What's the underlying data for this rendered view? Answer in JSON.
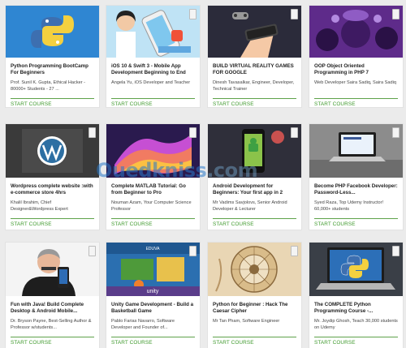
{
  "cta_label": "START COURSE",
  "courses": [
    {
      "title": "Python Programming BootCamp For Beginners",
      "author": "Prof. Sunil K. Gupta, Ethical Hacker - 80000+ Students - 27 ..."
    },
    {
      "title": "iOS 10 & Swift 3 - Mobile App Development Beginning to End",
      "author": "Angela Yu, iOS Developer and Teacher"
    },
    {
      "title": "BUILD VIRTUAL REALITY GAMES FOR GOOGLE",
      "author": "Dinesh Tavasalkar, Engineer, Developer, Technical Trainer"
    },
    {
      "title": "OOP Object Oriented Programming in PHP 7",
      "author": "Web Developer Saira Sadiq, Saira Sadiq"
    },
    {
      "title": "Wordpress complete website :with e-commerce store 4hrs",
      "author": "Khalil Ibrahim, Chief Designer&Wordpress Expert"
    },
    {
      "title": "Complete MATLAB Tutorial: Go from Beginner to Pro",
      "author": "Nouman Azam, Your Computer Science Professor"
    },
    {
      "title": "Android Development for Beginners: Your first app in 2",
      "author": "Mr Vadims Savjolovs, Senior Android Developer & Lecturer"
    },
    {
      "title": "Become PHP Facebook Developer: Password-Less...",
      "author": "Syed Raza, Top Udemy Instructor! 60,000+ students"
    },
    {
      "title": "Fun with Java! Build Complete Desktop & Android Mobile...",
      "author": "Dr. Bryson Payne, Best-Selling Author & Professor w/students..."
    },
    {
      "title": "Unity Game Development - Build a Basketball Game",
      "author": "Pablo Farias Navarro, Software Developer and Founder of..."
    },
    {
      "title": "Python for Beginner : Hack The Caesar Cipher",
      "author": "Mr Tan Pham, Software Engineer"
    },
    {
      "title": "The COMPLETE Python Programming Course -...",
      "author": "Mr. Joydip Ghosh, Teach 30,000 students on Udemy"
    }
  ],
  "watermark": {
    "main": "Ouedkniss",
    "tail": ".com"
  },
  "thumb_labels": {
    "unity": "unity",
    "matlab": "EDUVA"
  },
  "icons": [
    "python-logo-icon",
    "ios-phone-icon",
    "vr-headset-icon",
    "php-oop-icon",
    "wordpress-logo-icon",
    "matlab-surface-icon",
    "android-phone-icon",
    "laptop-icon",
    "instructor-photo",
    "unity-game-icon",
    "caesar-cipher-icon",
    "python-laptop-icon"
  ],
  "colors": {
    "cta": "#3f9a2d",
    "divider": "#5fa34a",
    "background": "#ebebeb"
  }
}
